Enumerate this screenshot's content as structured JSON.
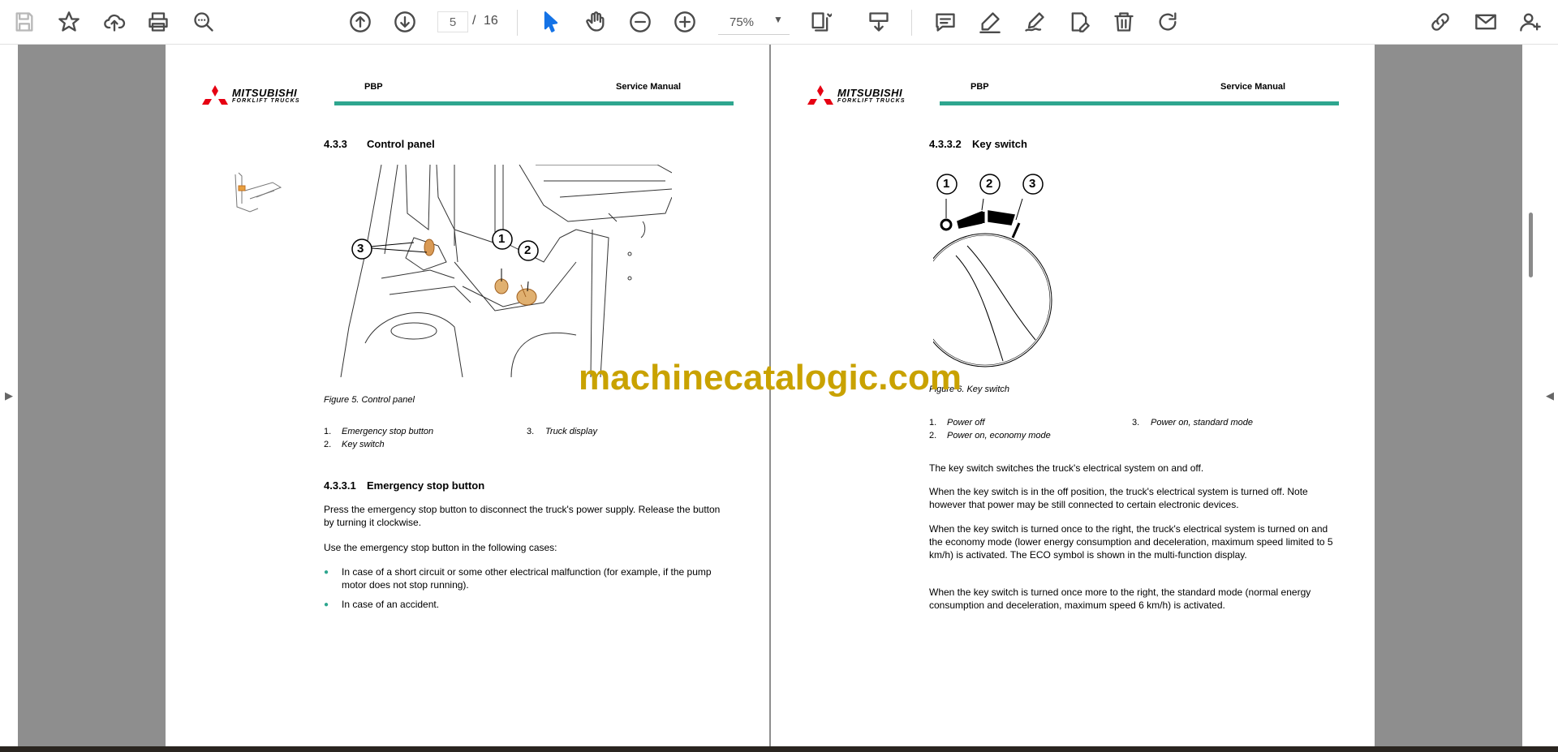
{
  "toolbar": {
    "page_current": "5",
    "page_separator": "/",
    "page_total": "16",
    "zoom": "75%",
    "icons": [
      "save-icon",
      "bookmark-star-icon",
      "upload-cloud-icon",
      "print-icon",
      "search-zoom-icon",
      "previous-page-icon",
      "next-page-icon",
      "select-arrow-icon",
      "hand-pan-icon",
      "zoom-out-icon",
      "zoom-in-icon",
      "fit-page-icon",
      "scroll-mode-icon",
      "comment-icon",
      "highlight-pen-icon",
      "draw-sign-icon",
      "edit-fill-icon",
      "delete-trash-icon",
      "rotate-icon",
      "share-link-icon",
      "email-icon",
      "add-user-icon"
    ]
  },
  "left_page": {
    "brand_top": "MITSUBISHI",
    "brand_bottom": "FORKLIFT TRUCKS",
    "header_left": "PBP",
    "header_right": "Service Manual",
    "section_number": "4.3.3",
    "section_title": "Control panel",
    "figure_callouts": [
      "1",
      "2",
      "3"
    ],
    "figure_caption": "Figure 5. Control panel",
    "legend": [
      {
        "num": "1.",
        "text": "Emergency stop button"
      },
      {
        "num": "2.",
        "text": "Key switch"
      },
      {
        "num": "3.",
        "text": "Truck display"
      }
    ],
    "subsection_number": "4.3.3.1",
    "subsection_title": "Emergency stop button",
    "para1": "Press the emergency stop button to disconnect the truck's power supply. Release the button by turning it clockwise.",
    "para2": "Use the emergency stop button in the following cases:",
    "bullet_symbol": "●",
    "bullets": [
      "In case of a short circuit or some other electrical malfunction (for example, if the pump motor does not stop running).",
      "In case of an accident."
    ]
  },
  "right_page": {
    "brand_top": "MITSUBISHI",
    "brand_bottom": "FORKLIFT TRUCKS",
    "header_left": "PBP",
    "header_right": "Service Manual",
    "section_number": "4.3.3.2",
    "section_title": "Key switch",
    "figure_callouts": [
      "1",
      "2",
      "3"
    ],
    "figure_caption": "Figure 6. Key switch",
    "legend": [
      {
        "num": "1.",
        "text": "Power off"
      },
      {
        "num": "2.",
        "text": "Power on, economy mode"
      },
      {
        "num": "3.",
        "text": "Power on, standard mode"
      }
    ],
    "para1": "The key switch switches the truck's electrical system on and off.",
    "para2": "When the key switch is in the off position, the truck's electrical system is turned off. Note however that power may be still connected to certain electronic devices.",
    "para3": "When the key switch is turned once to the right, the truck's electrical system is turned on and the economy mode (lower energy consumption and deceleration, maximum speed limited to 5 km/h) is activated. The ECO symbol is shown in the multi-function display.",
    "para4": "When the key switch is turned once more to the right, the standard mode (normal energy consumption and deceleration, maximum speed 6 km/h) is activated."
  },
  "watermark": "machinecatalogic.com",
  "colors": {
    "accent_line": "#2ea68f",
    "brand_red": "#e60012",
    "watermark": "#c9a200",
    "active_tool": "#1473e6"
  }
}
